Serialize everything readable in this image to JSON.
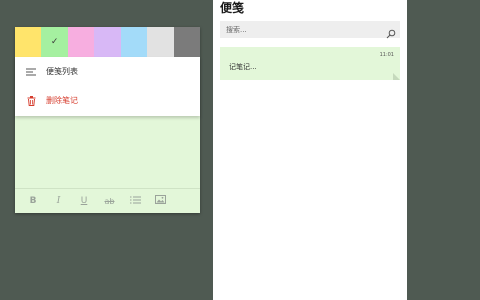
{
  "note_window": {
    "colors": [
      {
        "name": "yellow",
        "hex": "#ffe46b",
        "selected": false
      },
      {
        "name": "green",
        "hex": "#a5f0a0",
        "selected": true
      },
      {
        "name": "pink",
        "hex": "#f7aee0",
        "selected": false
      },
      {
        "name": "purple",
        "hex": "#d8b8f6",
        "selected": false
      },
      {
        "name": "blue",
        "hex": "#a3dbf9",
        "selected": false
      },
      {
        "name": "gray",
        "hex": "#e2e2e2",
        "selected": false
      },
      {
        "name": "charcoal",
        "hex": "#7b7b7b",
        "selected": false
      }
    ],
    "selected_check": "✓",
    "menu": {
      "list_label": "便笺列表",
      "delete_label": "删除笔记"
    },
    "format": {
      "bold": "B",
      "italic": "I",
      "underline": "U",
      "strike": "ab"
    }
  },
  "list_panel": {
    "title": "便笺",
    "search": {
      "placeholder": "搜索...",
      "value": ""
    },
    "notes": [
      {
        "time": "11:01",
        "preview": "记笔记...",
        "color": "#e3f7d9"
      }
    ]
  }
}
